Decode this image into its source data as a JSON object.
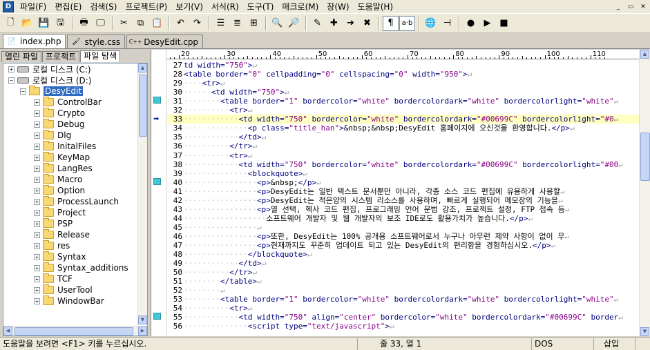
{
  "menu": {
    "items": [
      "파일(F)",
      "편집(E)",
      "검색(S)",
      "프로젝트(P)",
      "보기(V)",
      "서식(R)",
      "도구(T)",
      "매크로(M)",
      "창(W)",
      "도움말(H)"
    ],
    "win_controls": [
      "_",
      "▭",
      "✕"
    ]
  },
  "toolbar": {
    "icons": [
      "new-file-icon",
      "open-folder-icon",
      "save-icon",
      "save-all-icon",
      "print-icon",
      "print-preview-icon",
      "cut-icon",
      "copy-icon",
      "paste-icon",
      "undo-icon",
      "redo-icon",
      "view-list-icon",
      "view-details-icon",
      "hex-view-icon",
      "find-icon",
      "find-files-icon",
      "bookmark-icon",
      "bookmark-add-icon",
      "bookmark-next-icon",
      "bookmark-clear-icon",
      "whitespace-toggle-icon",
      "word-wrap-toggle-icon",
      "browser-icon",
      "pin-icon",
      "record-macro-icon",
      "macro-play-icon",
      "macro-stop-icon"
    ],
    "word_wrap_label": "a·b"
  },
  "doc_tabs": [
    {
      "label": "index.php",
      "icon": "php-file-icon",
      "active": true
    },
    {
      "label": "style.css",
      "icon": "css-file-icon",
      "active": false
    },
    {
      "label": "DesyEdit.cpp",
      "icon": "cpp-file-icon",
      "active": false
    }
  ],
  "panel_tabs": [
    "열린 파일",
    "프로젝트",
    "파일 탐색"
  ],
  "tree": {
    "drives": [
      {
        "label": "로컬 디스크 (C:)",
        "expander": "+"
      },
      {
        "label": "로컬 디스크 (D:)",
        "expander": "−"
      }
    ],
    "root": {
      "label": "DesyEdit",
      "expander": "−"
    },
    "folders": [
      "ControlBar",
      "Crypto",
      "Debug",
      "Dlg",
      "InitalFiles",
      "KeyMap",
      "LangRes",
      "Macro",
      "Option",
      "ProcessLaunch",
      "Project",
      "PSP",
      "Release",
      "res",
      "Syntax",
      "Syntax_additions",
      "TCF",
      "UserTool",
      "WindowBar"
    ]
  },
  "ruler": {
    "numbers": [
      "20",
      "30",
      "40",
      "50",
      "60",
      "70",
      "80",
      "90",
      "100",
      "110"
    ]
  },
  "editor": {
    "current_line": 33,
    "lines": [
      {
        "n": "27",
        "ws": "",
        "segs": [
          [
            "cl",
            "td width="
          ],
          [
            "str",
            "\"750\""
          ],
          [
            "cl",
            ">"
          ]
        ]
      },
      {
        "n": "28",
        "ws": "",
        "segs": [
          [
            "tag",
            "<table border="
          ],
          [
            "str",
            "\"0\""
          ],
          [
            "tag",
            " cellpadding="
          ],
          [
            "str",
            "\"0\""
          ],
          [
            "tag",
            " cellspacing="
          ],
          [
            "str",
            "\"0\""
          ],
          [
            "tag",
            " width="
          ],
          [
            "str",
            "\"950\""
          ],
          [
            "tag",
            ">"
          ]
        ]
      },
      {
        "n": "29",
        "ws": "····",
        "segs": [
          [
            "tag",
            "<tr>"
          ]
        ]
      },
      {
        "n": "30",
        "ws": "······",
        "segs": [
          [
            "tag",
            "<td width="
          ],
          [
            "str",
            "\"750\""
          ],
          [
            "tag",
            ">"
          ]
        ]
      },
      {
        "n": "31",
        "ws": "········",
        "segs": [
          [
            "tag",
            "<table border="
          ],
          [
            "str",
            "\"1\""
          ],
          [
            "tag",
            " bordercolor="
          ],
          [
            "str",
            "\"white\""
          ],
          [
            "tag",
            " bordercolordark="
          ],
          [
            "str",
            "\"white\""
          ],
          [
            "tag",
            " bordercolorlight="
          ],
          [
            "str",
            "\"white\""
          ]
        ]
      },
      {
        "n": "32",
        "ws": "··········",
        "segs": [
          [
            "tag",
            "<tr>"
          ]
        ]
      },
      {
        "n": "33",
        "ws": "············",
        "segs": [
          [
            "tag",
            "<td width="
          ],
          [
            "str",
            "\"750\""
          ],
          [
            "tag",
            " bordercolor="
          ],
          [
            "str",
            "\"white\""
          ],
          [
            "tag",
            " bordercolordark="
          ],
          [
            "str",
            "\"#00699C\""
          ],
          [
            "tag",
            " bordercolorlight="
          ],
          [
            "str",
            "\"#0"
          ]
        ]
      },
      {
        "n": "34",
        "ws": "··············",
        "segs": [
          [
            "tag",
            "<p class="
          ],
          [
            "str",
            "\"title_han\""
          ],
          [
            "tag",
            ">"
          ],
          [
            "txt",
            "&nbsp;&nbsp;DesyEdit 홈페이지에 오신것을 환영합니다."
          ],
          [
            "tag",
            "</p>"
          ]
        ]
      },
      {
        "n": "35",
        "ws": "············",
        "segs": [
          [
            "tag",
            "</td>"
          ]
        ]
      },
      {
        "n": "36",
        "ws": "··········",
        "segs": [
          [
            "tag",
            "</tr>"
          ]
        ]
      },
      {
        "n": "37",
        "ws": "··········",
        "segs": [
          [
            "tag",
            "<tr>"
          ]
        ]
      },
      {
        "n": "38",
        "ws": "············",
        "segs": [
          [
            "tag",
            "<td width="
          ],
          [
            "str",
            "\"750\""
          ],
          [
            "tag",
            " bordercolor="
          ],
          [
            "str",
            "\"white\""
          ],
          [
            "tag",
            " bordercolordark="
          ],
          [
            "str",
            "\"#00699C\""
          ],
          [
            "tag",
            " bordercolorlight="
          ],
          [
            "str",
            "\"#00"
          ]
        ]
      },
      {
        "n": "39",
        "ws": "··············",
        "segs": [
          [
            "tag",
            "<blockquote>"
          ]
        ]
      },
      {
        "n": "40",
        "ws": "················",
        "segs": [
          [
            "tag",
            "<p>"
          ],
          [
            "txt",
            "&nbsp;"
          ],
          [
            "tag",
            "</p>"
          ]
        ]
      },
      {
        "n": "41",
        "ws": "················",
        "segs": [
          [
            "tag",
            "<p>"
          ],
          [
            "txt",
            "DesyEdit는 일반 텍스트 문서뿐만 아니라, 각종 소스 코드 편집에 유용하게 사용할"
          ]
        ]
      },
      {
        "n": "42",
        "ws": "················",
        "segs": [
          [
            "tag",
            "<p>"
          ],
          [
            "txt",
            "DesyEdit는 적은양의 시스템 리소스를 사용하며, 빠르게 실행되어 메모장의 기능을"
          ]
        ]
      },
      {
        "n": "43",
        "ws": "················",
        "segs": [
          [
            "tag",
            "<p>"
          ],
          [
            "txt",
            "열 선택, 헥사 코드 편집, 프로그래밍 언어 문법 강조, 프로젝트 설정, FTP 접속 등"
          ]
        ]
      },
      {
        "n": "44",
        "ws": "··················",
        "segs": [
          [
            "txt",
            "소프트웨어 개발자 및 웹 개발자의 보조 IDE로도 활용가치가 높습니다."
          ],
          [
            "tag",
            "</p>"
          ]
        ]
      },
      {
        "n": "45",
        "ws": "················",
        "segs": []
      },
      {
        "n": "46",
        "ws": "················",
        "segs": [
          [
            "tag",
            "<p>"
          ],
          [
            "txt",
            "또한, DesyEdit는 100% 공개용 소프트웨어로서 누구나 아무런 제약 사항이 없이 무"
          ]
        ]
      },
      {
        "n": "47",
        "ws": "················",
        "segs": [
          [
            "tag",
            "<p>"
          ],
          [
            "txt",
            "현재까지도 꾸준히 업데이트 되고 있는 DesyEdit의 편리함을 경험하십시오."
          ],
          [
            "tag",
            "</p>"
          ]
        ]
      },
      {
        "n": "48",
        "ws": "··············",
        "segs": [
          [
            "tag",
            "</blockquote>"
          ]
        ]
      },
      {
        "n": "49",
        "ws": "············",
        "segs": [
          [
            "tag",
            "</td>"
          ]
        ]
      },
      {
        "n": "50",
        "ws": "··········",
        "segs": [
          [
            "tag",
            "</tr>"
          ]
        ]
      },
      {
        "n": "51",
        "ws": "········",
        "segs": [
          [
            "tag",
            "</table>"
          ]
        ]
      },
      {
        "n": "52",
        "ws": "········",
        "segs": []
      },
      {
        "n": "53",
        "ws": "········",
        "segs": [
          [
            "tag",
            "<table border="
          ],
          [
            "str",
            "\"1\""
          ],
          [
            "tag",
            " bordercolor="
          ],
          [
            "str",
            "\"white\""
          ],
          [
            "tag",
            " bordercolordark="
          ],
          [
            "str",
            "\"white\""
          ],
          [
            "tag",
            " bordercolorlight="
          ],
          [
            "str",
            "\"white\""
          ]
        ]
      },
      {
        "n": "54",
        "ws": "··········",
        "segs": [
          [
            "tag",
            "<tr>"
          ]
        ]
      },
      {
        "n": "55",
        "ws": "············",
        "segs": [
          [
            "tag",
            "<td width="
          ],
          [
            "str",
            "\"750\""
          ],
          [
            "tag",
            " align="
          ],
          [
            "str",
            "\"center\""
          ],
          [
            "tag",
            " bordercolor="
          ],
          [
            "str",
            "\"white\""
          ],
          [
            "tag",
            " bordercolordark="
          ],
          [
            "str",
            "\"#00699C\""
          ],
          [
            "tag",
            " border"
          ]
        ]
      },
      {
        "n": "56",
        "ws": "··············",
        "segs": [
          [
            "tag",
            "<script type="
          ],
          [
            "str",
            "\"text/javascript\""
          ],
          [
            "tag",
            ">"
          ]
        ]
      }
    ]
  },
  "status": {
    "help": "도움말을 보려면 <F1> 키를 누르십시오.",
    "position": "줄 33, 열 1",
    "encoding": "DOS",
    "mode": "삽입"
  },
  "colors": {
    "tag": "#000080",
    "string": "#8b008b",
    "current_line": "#ffffc0",
    "selection": "#316ac5",
    "bookmark": "#41c9d9"
  }
}
